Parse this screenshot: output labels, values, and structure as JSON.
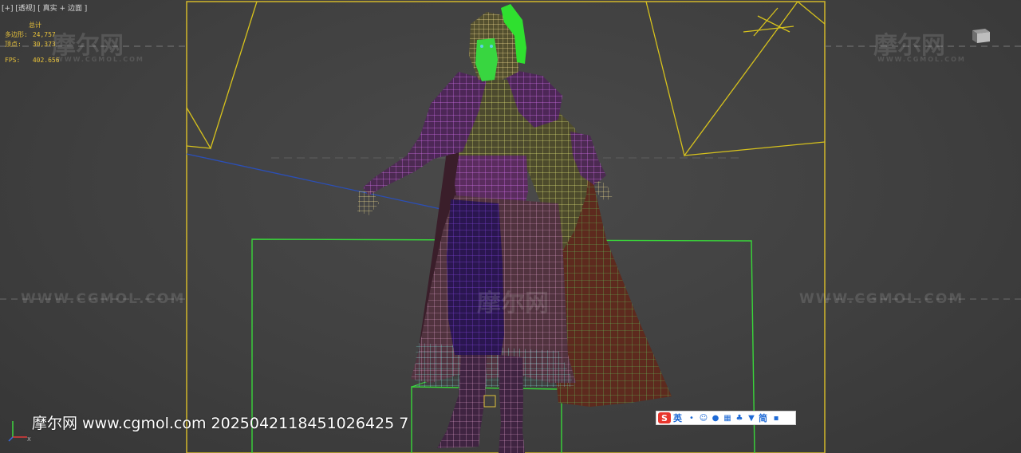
{
  "viewport": {
    "label": "[+] [透视] [ 真实 + 边面 ]"
  },
  "stats": {
    "total_label": "总计",
    "polys_label": "多边形:",
    "polys_value": "24,757",
    "verts_label": "顶点:",
    "verts_value": "30,373",
    "fps_label": "FPS:",
    "fps_value": "402.656"
  },
  "watermarks": {
    "logo": "摩尔网",
    "domain": "WWW.CGMOL.COM",
    "url": "WWW.CGMOL.COM"
  },
  "stamp": {
    "text": "摩尔网 www.cgmol.com 2025042118451026425 7"
  },
  "ime_bar": {
    "logo": "S",
    "lang": "英",
    "mode": "简"
  },
  "colors": {
    "viewport_border": "#d2b72a",
    "gate_lines": "#d7c21c",
    "ground_box": "#39d63a",
    "wire_purple": "#c25ae0",
    "wire_yellow": "#d7d86a",
    "wire_green": "#2fe02f",
    "cape": "#5d2a1e"
  }
}
